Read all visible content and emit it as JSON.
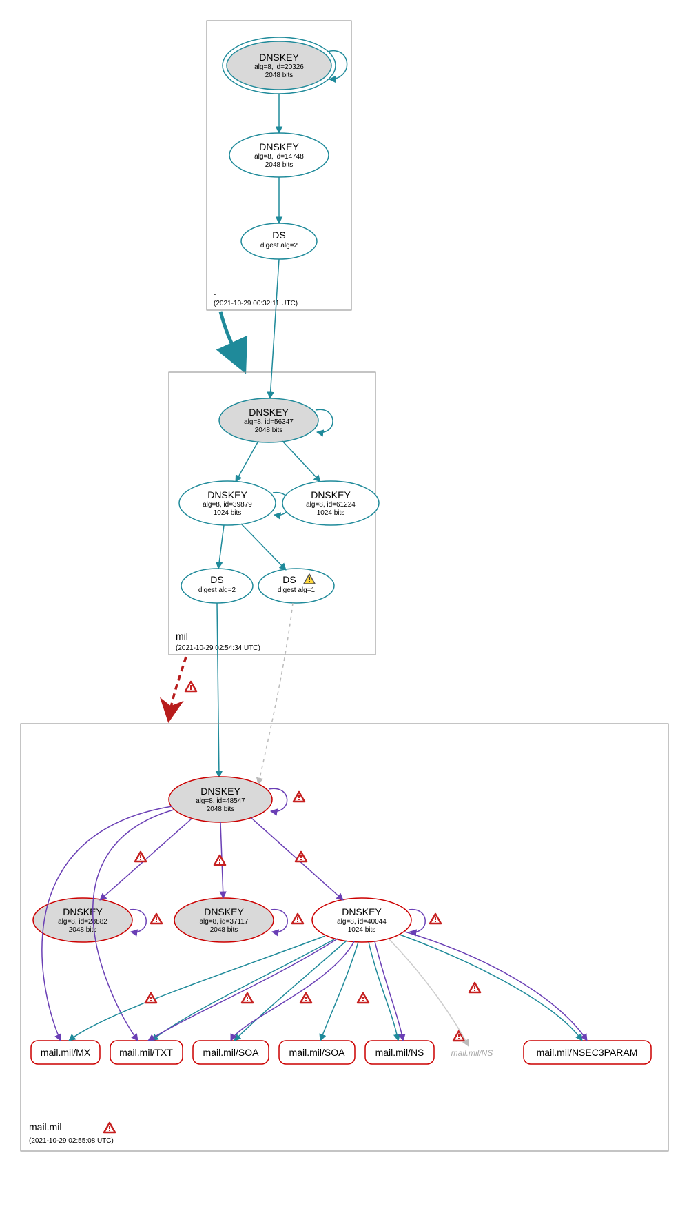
{
  "zones": {
    "root": {
      "label": ".",
      "timestamp": "(2021-10-29 00:32:11 UTC)",
      "nodes": {
        "dnskey1": {
          "title": "DNSKEY",
          "line2": "alg=8, id=20326",
          "line3": "2048 bits"
        },
        "dnskey2": {
          "title": "DNSKEY",
          "line2": "alg=8, id=14748",
          "line3": "2048 bits"
        },
        "ds": {
          "title": "DS",
          "line2": "digest alg=2"
        }
      }
    },
    "mil": {
      "label": "mil",
      "timestamp": "(2021-10-29 02:54:34 UTC)",
      "nodes": {
        "dnskey1": {
          "title": "DNSKEY",
          "line2": "alg=8, id=56347",
          "line3": "2048 bits"
        },
        "dnskey2": {
          "title": "DNSKEY",
          "line2": "alg=8, id=39879",
          "line3": "1024 bits"
        },
        "dnskey3": {
          "title": "DNSKEY",
          "line2": "alg=8, id=61224",
          "line3": "1024 bits"
        },
        "ds1": {
          "title": "DS",
          "line2": "digest alg=2"
        },
        "ds2": {
          "title": "DS",
          "line2": "digest alg=1"
        }
      }
    },
    "mailmil": {
      "label": "mail.mil",
      "timestamp": "(2021-10-29 02:55:08 UTC)",
      "nodes": {
        "dnskey1": {
          "title": "DNSKEY",
          "line2": "alg=8, id=48547",
          "line3": "2048 bits"
        },
        "dnskey2": {
          "title": "DNSKEY",
          "line2": "alg=8, id=28882",
          "line3": "2048 bits"
        },
        "dnskey3": {
          "title": "DNSKEY",
          "line2": "alg=8, id=37117",
          "line3": "2048 bits"
        },
        "dnskey4": {
          "title": "DNSKEY",
          "line2": "alg=8, id=40044",
          "line3": "1024 bits"
        }
      },
      "rrsets": {
        "mx": "mail.mil/MX",
        "txt": "mail.mil/TXT",
        "soa1": "mail.mil/SOA",
        "soa2": "mail.mil/SOA",
        "ns": "mail.mil/NS",
        "ns_ghost": "mail.mil/NS",
        "nsec3": "mail.mil/NSEC3PARAM"
      }
    }
  },
  "colors": {
    "teal": "#1f8a9a",
    "purple": "#6a3fb5",
    "red": "#cc0000",
    "grey": "#bbbbbb"
  }
}
